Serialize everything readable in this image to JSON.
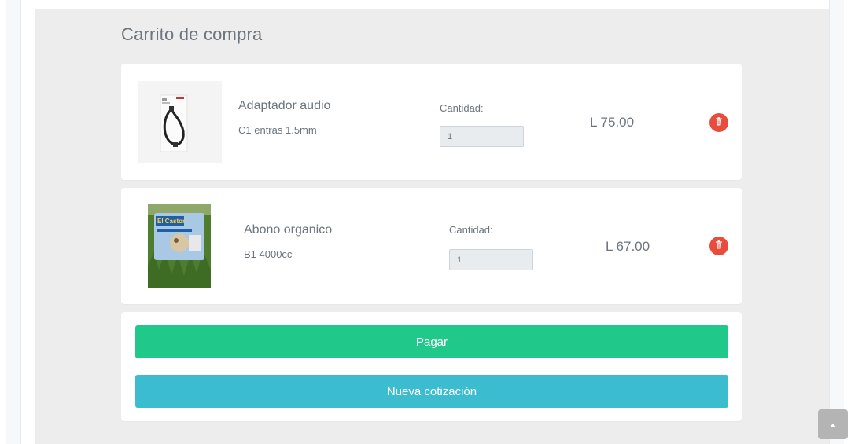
{
  "cart": {
    "title": "Carrito de compra",
    "items": [
      {
        "name": "Adaptador audio",
        "description": "C1 entras 1.5mm",
        "quantity_label": "Cantidad:",
        "quantity": "1",
        "price": "L 75.00",
        "image": "audio-adapter-cable-package"
      },
      {
        "name": "Abono organico",
        "description": "B1 4000cc",
        "quantity_label": "Cantidad:",
        "quantity": "1",
        "price": "L 67.00",
        "image": "organic-fertilizer-bag",
        "image_text": "El Castor"
      }
    ],
    "actions": {
      "pay_label": "Pagar",
      "new_quote_label": "Nueva cotización"
    }
  },
  "icons": {
    "delete": "trash-icon",
    "scroll_top": "chevron-up-icon"
  },
  "colors": {
    "pay_button": "#20c98a",
    "quote_button": "#3bbccf",
    "delete_button": "#e74c3c",
    "panel_background": "#ededed"
  }
}
